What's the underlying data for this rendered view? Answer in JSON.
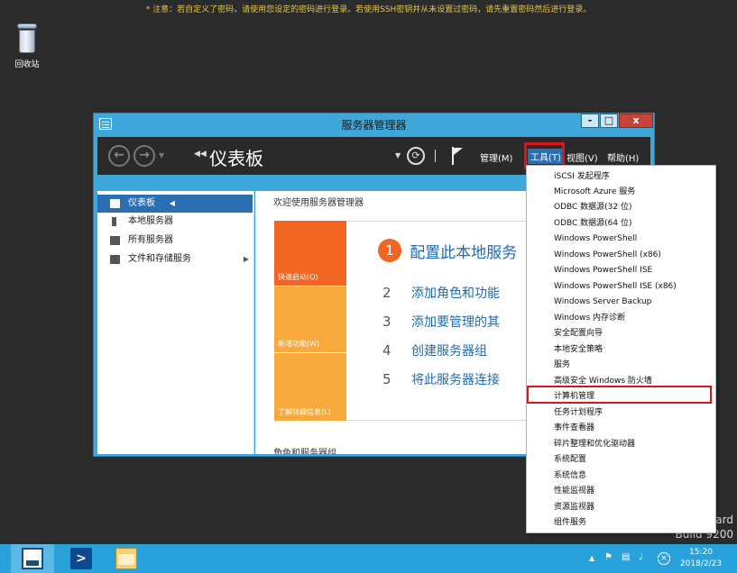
{
  "notice": "* 注意：若自定义了密码，请使用您设定的密码进行登录。若使用SSH密钥并从未设置过密码，请先重置密码然后进行登录。",
  "desktop": {
    "recycle_bin_label": "回收站"
  },
  "watermark": {
    "line1": "lard",
    "line2": "Build 9200"
  },
  "window": {
    "title": "服务器管理器",
    "min": "-",
    "max": "□",
    "close": "x",
    "breadcrumb": "仪表板",
    "menus": [
      "管理(M)",
      "工具(T)",
      "视图(V)",
      "帮助(H)"
    ],
    "sidebar": [
      {
        "label": "仪表板",
        "active": true
      },
      {
        "label": "本地服务器"
      },
      {
        "label": "所有服务器"
      },
      {
        "label": "文件和存储服务"
      }
    ],
    "welcome": "欢迎使用服务器管理器",
    "tiles": [
      "快速启动(Q)",
      "新增功能(W)",
      "了解详细信息(L)"
    ],
    "step1": {
      "num": "1",
      "text": "配置此本地服务"
    },
    "steps": [
      {
        "num": "2",
        "text": "添加角色和功能"
      },
      {
        "num": "3",
        "text": "添加要管理的其"
      },
      {
        "num": "4",
        "text": "创建服务器组"
      },
      {
        "num": "5",
        "text": "将此服务器连接"
      }
    ],
    "roles_heading": "角色和服务器组"
  },
  "tools_menu": [
    "iSCSI 发起程序",
    "Microsoft Azure 服务",
    "ODBC 数据源(32 位)",
    "ODBC 数据源(64 位)",
    "Windows PowerShell",
    "Windows PowerShell (x86)",
    "Windows PowerShell ISE",
    "Windows PowerShell ISE (x86)",
    "Windows Server Backup",
    "Windows 内存诊断",
    "安全配置向导",
    "本地安全策略",
    "服务",
    "高级安全 Windows 防火墙",
    "计算机管理",
    "任务计划程序",
    "事件查看器",
    "碎片整理和优化驱动器",
    "系统配置",
    "系统信息",
    "性能监视器",
    "资源监视器",
    "组件服务"
  ],
  "highlighted_item": "计算机管理",
  "taskbar": {
    "time": "15:20",
    "date": "2018/2/23"
  },
  "colors": {
    "accent": "#2b6fb3",
    "tile_orange": "#f26522",
    "tile_light": "#f7a93b",
    "highlight": "#d9161c",
    "taskbar": "#29a2dc"
  }
}
